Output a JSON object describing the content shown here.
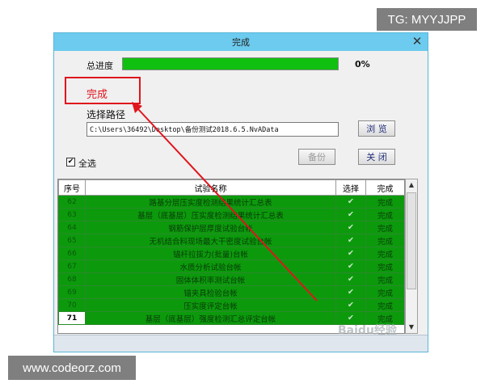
{
  "watermarks": {
    "top": "TG: MYYJJPP",
    "bottom": "www.codeorz.com"
  },
  "window": {
    "title": "完成"
  },
  "progress": {
    "label": "总进度",
    "percent_text": "0%",
    "fill": 1.0
  },
  "status_text": "完成",
  "path": {
    "label": "选择路径",
    "value": "C:\\Users\\36492\\Desktop\\备份测试2018.6.5.NvAData"
  },
  "buttons": {
    "browse": "浏 览",
    "backup": "备份",
    "close": "关 闭"
  },
  "select_all": {
    "label": "全选",
    "checked": true
  },
  "table": {
    "headers": [
      "序号",
      "试验名称",
      "选择",
      "完成"
    ],
    "rows": [
      {
        "no": "62",
        "name": "路基分层压实度检测结果统计汇总表",
        "check": "✔",
        "done": "完成"
      },
      {
        "no": "63",
        "name": "基层（底基层）压实度检测结果统计汇总表",
        "check": "✔",
        "done": "完成"
      },
      {
        "no": "64",
        "name": "钢筋保护层厚度试验台帐",
        "check": "✔",
        "done": "完成"
      },
      {
        "no": "65",
        "name": "无机结合料现场最大干密度试验台帐",
        "check": "✔",
        "done": "完成"
      },
      {
        "no": "66",
        "name": "锚杆拉拔力(批量)台帐",
        "check": "✔",
        "done": "完成"
      },
      {
        "no": "67",
        "name": "水质分析试验台帐",
        "check": "✔",
        "done": "完成"
      },
      {
        "no": "68",
        "name": "固体体积率测试台帐",
        "check": "✔",
        "done": "完成"
      },
      {
        "no": "69",
        "name": "锚夹具检验台帐",
        "check": "✔",
        "done": "完成"
      },
      {
        "no": "70",
        "name": "压实度评定台帐",
        "check": "✔",
        "done": "完成"
      },
      {
        "no": "71",
        "name": "基层（底基层）强度检测汇总评定台帐",
        "check": "✔",
        "done": "完成"
      }
    ]
  },
  "overlay": {
    "logo_text": "Baidu经验"
  },
  "colors": {
    "title_bar": "#6ccbee",
    "progress_fill": "#10c010",
    "row_bg": "#0c9a0c",
    "highlight": "#e0151d"
  }
}
